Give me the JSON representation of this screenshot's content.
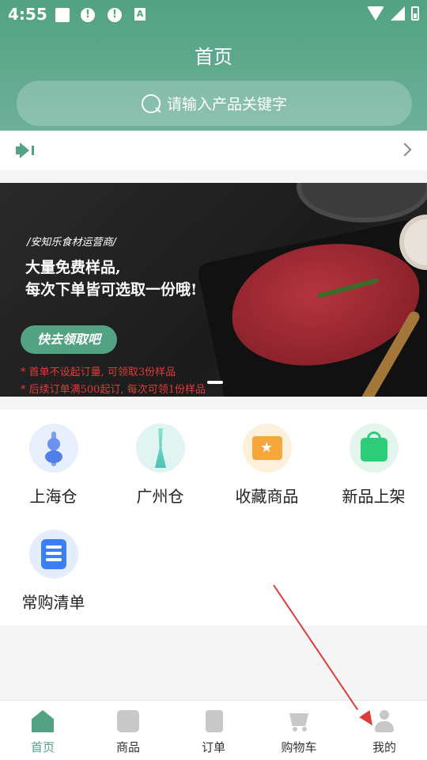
{
  "status_bar": {
    "time": "4:55",
    "alert1": "!",
    "alert2": "!",
    "app_badge": "A"
  },
  "header": {
    "title": "首页",
    "search_placeholder": "请输入产品关键字"
  },
  "banner": {
    "subtitle": "/安知乐食材运营商/",
    "headline_line1": "大量免费样品,",
    "headline_line2": "每次下单皆可选取一份哦!",
    "cta": "快去领取吧",
    "note1": "* 首单不设起订量, 可领取3份样品",
    "note2": "* 后续订单满500起订, 每次可领1份样品"
  },
  "categories": [
    {
      "label": "上海仓",
      "icon": "shanghai-tower-icon"
    },
    {
      "label": "广州仓",
      "icon": "canton-tower-icon"
    },
    {
      "label": "收藏商品",
      "icon": "favorite-folder-icon"
    },
    {
      "label": "新品上架",
      "icon": "shopping-bag-icon"
    },
    {
      "label": "常购清单",
      "icon": "list-icon"
    }
  ],
  "bottom_nav": [
    {
      "label": "首页",
      "icon": "home-icon",
      "active": true
    },
    {
      "label": "商品",
      "icon": "goods-icon",
      "active": false
    },
    {
      "label": "订单",
      "icon": "order-icon",
      "active": false
    },
    {
      "label": "购物车",
      "icon": "cart-icon",
      "active": false
    },
    {
      "label": "我的",
      "icon": "profile-icon",
      "active": false
    }
  ],
  "colors": {
    "brand_green": "#52a283",
    "annotation_red": "#e03a3a"
  }
}
